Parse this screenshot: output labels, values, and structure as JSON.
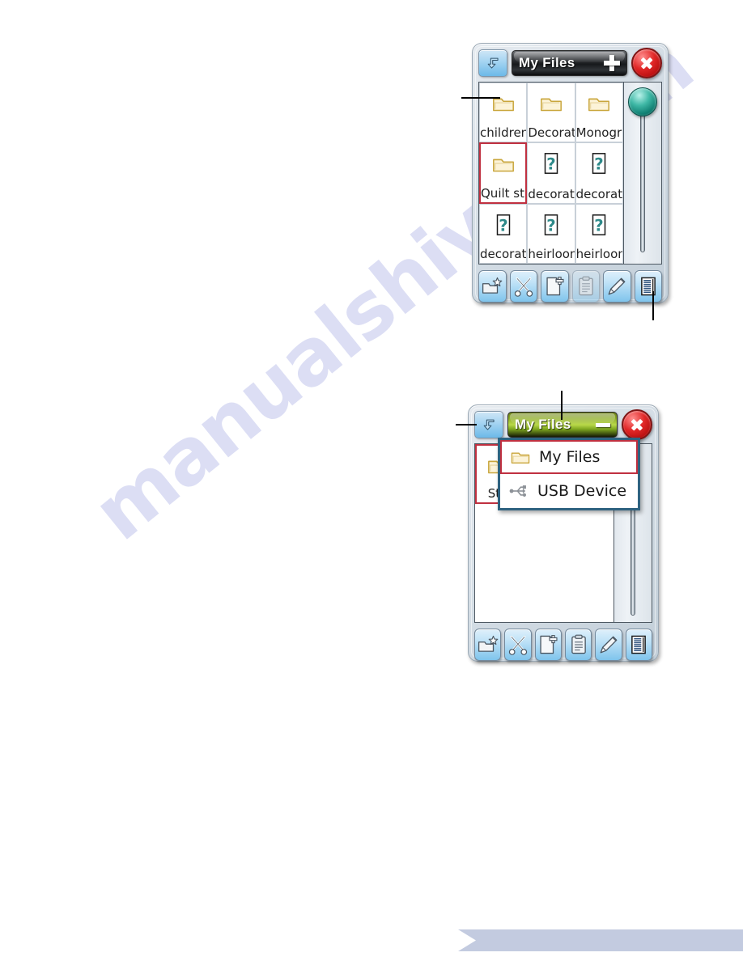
{
  "watermark": {
    "text": "manualshive.com"
  },
  "dialog1": {
    "nav_icon": "back-up-arrow-icon",
    "title": "My Files",
    "add_icon": "plus-icon",
    "close_icon": "close-icon",
    "items": [
      {
        "label": "children",
        "icon": "folder-icon",
        "selected": false
      },
      {
        "label": "Decorat",
        "icon": "folder-icon",
        "selected": false
      },
      {
        "label": "Monogra",
        "icon": "folder-icon",
        "selected": false
      },
      {
        "label": "Quilt sti",
        "icon": "folder-icon",
        "selected": true
      },
      {
        "label": "decorat",
        "icon": "unknown-file-icon",
        "selected": false
      },
      {
        "label": "decorat",
        "icon": "unknown-file-icon",
        "selected": false
      },
      {
        "label": "decorat",
        "icon": "unknown-file-icon",
        "selected": false
      },
      {
        "label": "heirloom",
        "icon": "unknown-file-icon",
        "selected": false
      },
      {
        "label": "heirloom",
        "icon": "unknown-file-icon",
        "selected": false
      }
    ],
    "scrollbar": {
      "knob_position": "top"
    },
    "toolbar": [
      {
        "name": "new-folder-button",
        "icon": "new-folder-icon",
        "disabled": false
      },
      {
        "name": "cut-button",
        "icon": "scissors-icon",
        "disabled": false
      },
      {
        "name": "new-file-button",
        "icon": "new-file-icon",
        "disabled": false
      },
      {
        "name": "paste-button",
        "icon": "clipboard-icon",
        "disabled": true
      },
      {
        "name": "rename-button",
        "icon": "pencil-icon",
        "disabled": false
      },
      {
        "name": "list-view-button",
        "icon": "list-view-icon",
        "disabled": false
      }
    ]
  },
  "dialog2": {
    "nav_icon": "back-up-arrow-icon",
    "title": "My Files",
    "collapse_icon": "minimize-dash-icon",
    "close_icon": "close-icon",
    "items": [
      {
        "label": "Stit",
        "icon": "folder-icon",
        "selected": true
      }
    ],
    "dropdown": {
      "options": [
        {
          "label": "My Files",
          "icon": "folder-icon",
          "selected": true
        },
        {
          "label": "USB Device",
          "icon": "usb-icon",
          "selected": false
        }
      ]
    },
    "toolbar": [
      {
        "name": "new-folder-button",
        "icon": "new-folder-icon",
        "disabled": false
      },
      {
        "name": "cut-button",
        "icon": "scissors-icon",
        "disabled": false
      },
      {
        "name": "new-file-button",
        "icon": "new-file-icon",
        "disabled": false
      },
      {
        "name": "paste-button",
        "icon": "clipboard-icon",
        "disabled": false
      },
      {
        "name": "rename-button",
        "icon": "pencil-icon",
        "disabled": false
      },
      {
        "name": "list-view-button",
        "icon": "list-view-icon",
        "disabled": false
      }
    ]
  },
  "colors": {
    "selection_red": "#c03040",
    "titlebar_dark": "#17191c",
    "titlebar_green": "#b9d94a",
    "close_red": "#e02626",
    "knob_teal": "#3fb8a6",
    "banner": "#c3cbe0",
    "watermark": "#c7cbee"
  }
}
